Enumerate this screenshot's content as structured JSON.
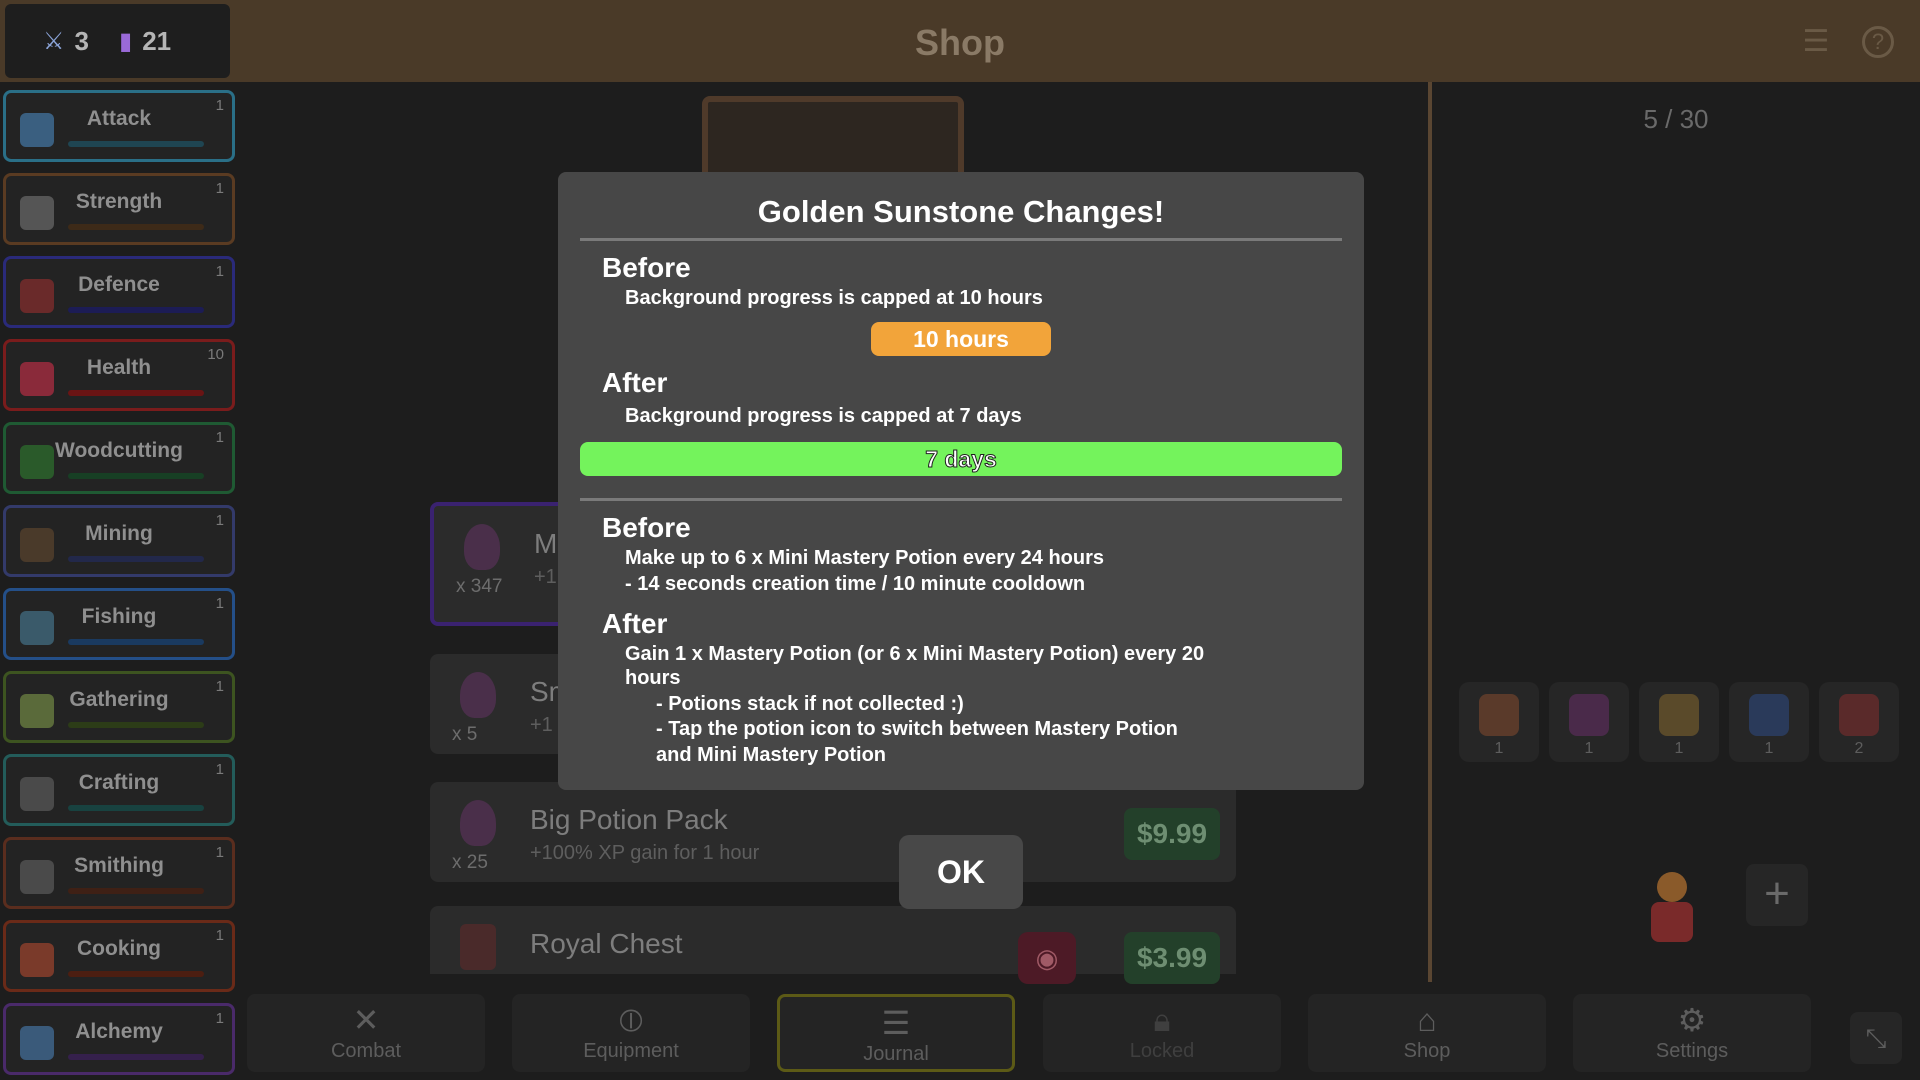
{
  "header": {
    "title": "Shop",
    "stats": [
      {
        "icon": "crossed-swords-icon",
        "value": "3"
      },
      {
        "icon": "bar-chart-icon",
        "value": "21"
      }
    ]
  },
  "sidebar": {
    "skills": [
      {
        "label": "Attack",
        "level": "1",
        "color": "#2a6f87"
      },
      {
        "label": "Strength",
        "level": "1",
        "color": "#5a3b22"
      },
      {
        "label": "Defence",
        "level": "1",
        "color": "#2a2a7a"
      },
      {
        "label": "Health",
        "level": "10",
        "color": "#7a1c1c"
      },
      {
        "label": "Woodcutting",
        "level": "1",
        "color": "#1f5a33"
      },
      {
        "label": "Mining",
        "level": "1",
        "color": "#333a6a"
      },
      {
        "label": "Fishing",
        "level": "1",
        "color": "#244f88"
      },
      {
        "label": "Gathering",
        "level": "1",
        "color": "#3d5420"
      },
      {
        "label": "Crafting",
        "level": "1",
        "color": "#235c5a"
      },
      {
        "label": "Smithing",
        "level": "1",
        "color": "#5a2d1e"
      },
      {
        "label": "Cooking",
        "level": "1",
        "color": "#6a2a18"
      },
      {
        "label": "Alchemy",
        "level": "1",
        "color": "#4a2a6a"
      }
    ]
  },
  "shop": {
    "items": [
      {
        "name": "M",
        "sub": "+1",
        "qty": "x 347"
      },
      {
        "name": "Sm",
        "sub": "+1",
        "qty": "x 5"
      },
      {
        "name": "Big Potion Pack",
        "sub": "+100% XP gain for 1 hour",
        "qty": "x 25",
        "price": "$9.99"
      },
      {
        "name": "Royal Chest",
        "sub": "",
        "qty": "",
        "price": "$3.99"
      }
    ]
  },
  "inventory": {
    "count": "5 / 30",
    "slots": [
      "1",
      "1",
      "1",
      "1",
      "2"
    ]
  },
  "nav": {
    "items": [
      {
        "label": "Combat",
        "icon": "crossed-swords-icon"
      },
      {
        "label": "Equipment",
        "icon": "shield-icon"
      },
      {
        "label": "Journal",
        "icon": "list-icon"
      },
      {
        "label": "Locked",
        "icon": "lock-icon"
      },
      {
        "label": "Shop",
        "icon": "store-icon"
      },
      {
        "label": "Settings",
        "icon": "gear-icon"
      }
    ]
  },
  "modal": {
    "title": "Golden Sunstone Changes!",
    "section1": {
      "before_head": "Before",
      "before_text": "Background progress is capped at 10 hours",
      "before_pill": "10 hours",
      "after_head": "After",
      "after_text": "Background progress is capped at 7 days",
      "after_bar": "7 days"
    },
    "section2": {
      "before_head": "Before",
      "before_line1": "Make up to 6 x Mini Mastery Potion every 24 hours",
      "before_line2": "- 14 seconds creation time / 10 minute cooldown",
      "after_head": "After",
      "after_line1": "Gain 1 x Mastery Potion (or 6 x Mini Mastery Potion) every 20",
      "after_line2": "hours",
      "bullet1": "- Potions stack if not collected :)",
      "bullet2a": "- Tap the potion icon to switch between Mastery Potion",
      "bullet2b": "and Mini Mastery Potion"
    },
    "ok_label": "OK",
    "colors": {
      "pill": "#f2a43a",
      "bar": "#74f35c"
    }
  }
}
